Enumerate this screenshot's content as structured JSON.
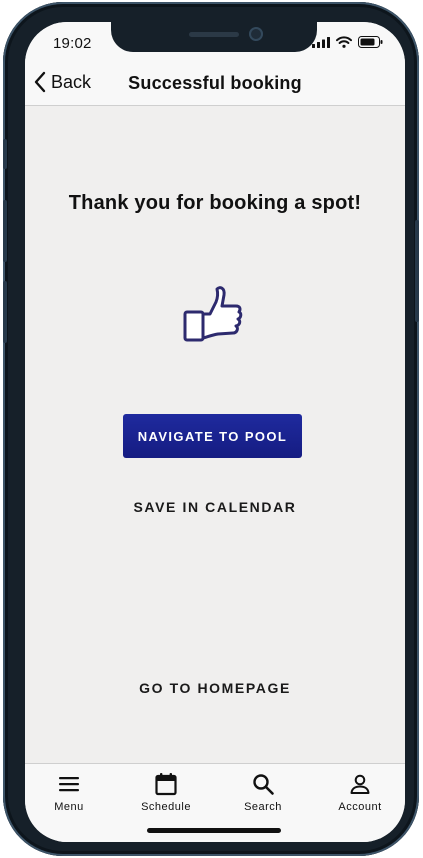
{
  "status_bar": {
    "time": "19:02"
  },
  "header": {
    "back_label": "Back",
    "title": "Successful booking"
  },
  "main": {
    "heading": "Thank you for booking a spot!",
    "icon": "thumbs-up-icon",
    "navigate_button": "NAVIGATE TO POOL",
    "save_calendar": "SAVE IN CALENDAR",
    "go_homepage": "GO TO HOMEPAGE"
  },
  "tabbar": {
    "items": [
      {
        "label": "Menu",
        "icon": "menu-icon"
      },
      {
        "label": "Schedule",
        "icon": "calendar-icon"
      },
      {
        "label": "Search",
        "icon": "search-icon"
      },
      {
        "label": "Account",
        "icon": "account-icon"
      }
    ]
  },
  "colors": {
    "primary": "#1a2290",
    "background": "#f0efee",
    "bar": "#f8f8f8",
    "icon_outline": "#2d2a6e"
  }
}
